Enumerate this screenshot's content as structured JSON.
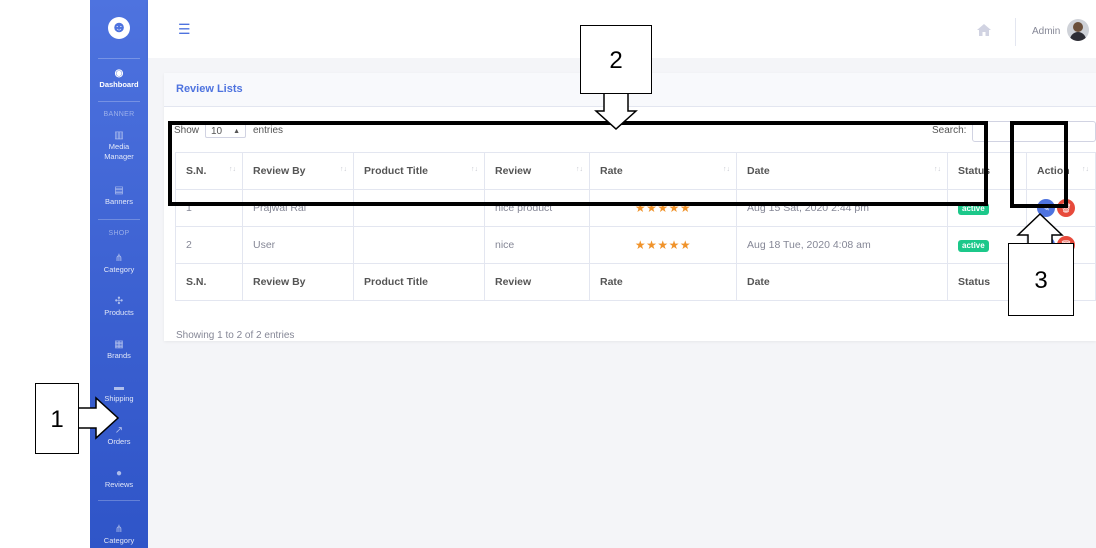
{
  "sidebar": {
    "logo": "☻",
    "items": [
      {
        "label": "Dashboard",
        "icon": "dashboard-icon",
        "glyph": "◉",
        "active": true
      },
      {
        "label": "Media Manager",
        "icon": "media-icon",
        "glyph": "▥"
      },
      {
        "label": "Banners",
        "icon": "image-icon",
        "glyph": "▤"
      },
      {
        "label": "Category",
        "icon": "sitemap-icon",
        "glyph": "⋔"
      },
      {
        "label": "Products",
        "icon": "cubes-icon",
        "glyph": "✣"
      },
      {
        "label": "Brands",
        "icon": "table-icon",
        "glyph": "▦"
      },
      {
        "label": "Shipping",
        "icon": "truck-icon",
        "glyph": "▬"
      },
      {
        "label": "Orders",
        "icon": "hammer-icon",
        "glyph": "↗"
      },
      {
        "label": "Reviews",
        "icon": "comments-icon",
        "glyph": "●"
      },
      {
        "label": "Category",
        "icon": "sitemap-icon",
        "glyph": "⋔"
      }
    ],
    "headings": {
      "banner": "BANNER",
      "shop": "SHOP"
    }
  },
  "topbar": {
    "menu_icon": "☰",
    "user_name": "Admin"
  },
  "card": {
    "title": "Review Lists",
    "show_label": "Show",
    "page_size": "10",
    "entries_label": "entries",
    "search_label": "Search:",
    "search_value": ""
  },
  "table": {
    "columns": [
      "S.N.",
      "Review By",
      "Product Title",
      "Review",
      "Rate",
      "Date",
      "Status",
      "Action"
    ],
    "sort_glyph": "↑↓",
    "rows": [
      {
        "sn": "1",
        "review_by": "Prajwal Rai",
        "product": "",
        "review": "nice product",
        "rate": "★★★★★",
        "date": "Aug 15 Sat, 2020 2:44 pm",
        "status": "active"
      },
      {
        "sn": "2",
        "review_by": "User",
        "product": "",
        "review": "nice",
        "rate": "★★★★★",
        "date": "Aug 18 Tue, 2020 4:08 am",
        "status": "active"
      }
    ],
    "footer": [
      "S.N.",
      "Review By",
      "Product Title",
      "Review",
      "Rate",
      "Date",
      "Status",
      "Action"
    ],
    "action_glyphs": {
      "edit": "✎",
      "delete": "🗑"
    }
  },
  "showing_text": "Showing 1 to 2 of 2 entries",
  "callouts": {
    "one": "1",
    "two": "2",
    "three": "3"
  },
  "colors": {
    "accent": "#4e73df",
    "success": "#1cc88a",
    "danger": "#e74a3b",
    "star": "#f0932b"
  }
}
